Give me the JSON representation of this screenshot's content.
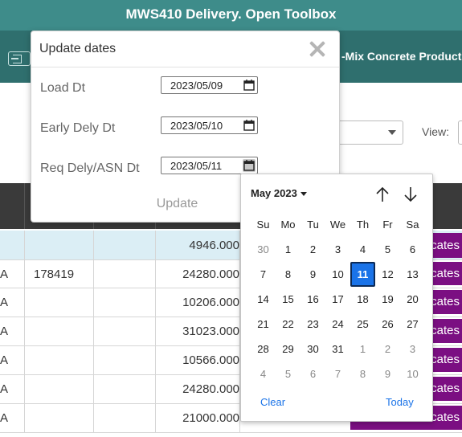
{
  "window": {
    "title": "MWS410 Delivery. Open Toolbox"
  },
  "toolbar": {
    "company_text": "-Mix Concrete Products"
  },
  "filters": {
    "view_label": "View:"
  },
  "table": {
    "rows": [
      {
        "c1": "",
        "c2": "",
        "c4": "4946.000",
        "pill": "cates"
      },
      {
        "c1": "A",
        "c2": "178419",
        "c4": "24280.000",
        "pill": "cates"
      },
      {
        "c1": "A",
        "c2": "",
        "c4": "10206.000",
        "pill": "cates"
      },
      {
        "c1": "A",
        "c2": "",
        "c4": "31023.000",
        "pill": "cates"
      },
      {
        "c1": "A",
        "c2": "",
        "c4": "10566.000",
        "pill": "cates"
      },
      {
        "c1": "A",
        "c2": "",
        "c4": "24280.000",
        "pill": "cates"
      },
      {
        "c1": "A",
        "c2": "",
        "c4": "21000.000",
        "pill": "cates"
      }
    ]
  },
  "modal": {
    "title": "Update dates",
    "fields": [
      {
        "label": "Load Dt",
        "value": "2023/05/09"
      },
      {
        "label": "Early Dely Dt",
        "value": "2023/05/10"
      },
      {
        "label": "Req Dely/ASN Dt",
        "value": "2023/05/11"
      }
    ],
    "update_label": "Update"
  },
  "calendar": {
    "month_label": "May 2023",
    "weekdays": [
      "Su",
      "Mo",
      "Tu",
      "We",
      "Th",
      "Fr",
      "Sa"
    ],
    "weeks": [
      [
        "30",
        "1",
        "2",
        "3",
        "4",
        "5",
        "6"
      ],
      [
        "7",
        "8",
        "9",
        "10",
        "11",
        "12",
        "13"
      ],
      [
        "14",
        "15",
        "16",
        "17",
        "18",
        "19",
        "20"
      ],
      [
        "21",
        "22",
        "23",
        "24",
        "25",
        "26",
        "27"
      ],
      [
        "28",
        "29",
        "30",
        "31",
        "1",
        "2",
        "3"
      ],
      [
        "4",
        "5",
        "6",
        "7",
        "8",
        "9",
        "10"
      ]
    ],
    "selected_day": "11",
    "clear_label": "Clear",
    "today_label": "Today"
  },
  "colors": {
    "title_bar": "#3e8c8a",
    "toolbar": "#2f6f6e",
    "pill": "#7b0f82",
    "selected": "#1a73e8"
  }
}
